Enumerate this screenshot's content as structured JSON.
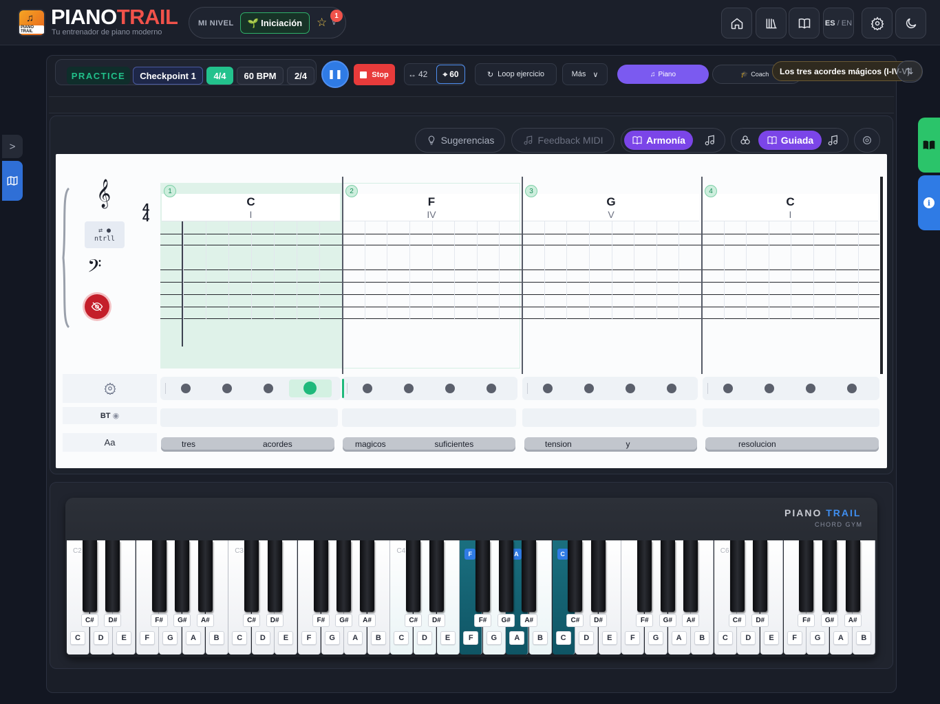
{
  "app": {
    "brand_part1": "PIANO",
    "brand_part2": "TRAIL",
    "logo_text": "PIANO TRAIL",
    "tagline": "Tu entrenador de piano moderno"
  },
  "level": {
    "label": "MI NIVEL",
    "value": "Iniciación",
    "notification_count": "1"
  },
  "header_buttons": {
    "home": "home-icon",
    "library": "library-icon",
    "book": "book-icon",
    "lang_active": "ES",
    "lang_sep": "/",
    "lang_other": "EN",
    "settings": "gear-icon",
    "theme": "moon-icon"
  },
  "toolbar": {
    "mode": "PRACTICE",
    "checkpoint": "Checkpoint 1",
    "meter": "4/4",
    "bpm": "60 BPM",
    "position": "2/4",
    "stop_label": "Stop",
    "width_value": "42",
    "target_value": "60",
    "loop_label": "Loop ejercicio",
    "more_label": "Más",
    "piano_tab": "Piano",
    "coach_tab": "Coach",
    "tooltip": "Los tres acordes mágicos (I-IV-V)"
  },
  "score_chips": {
    "suggestions": "Sugerencias",
    "midi_feedback": "Feedback MIDI",
    "harmony": "Armonía",
    "guided": "Guiada"
  },
  "score": {
    "time_signature_top": "4",
    "time_signature_bottom": "4",
    "control_label": "ntrll",
    "bt_label": "BT",
    "lyrics_row_label": "Aa",
    "measures": [
      {
        "number": "1",
        "chord": "C",
        "roman": "I"
      },
      {
        "number": "2",
        "chord": "F",
        "roman": "IV"
      },
      {
        "number": "3",
        "chord": "G",
        "roman": "V"
      },
      {
        "number": "4",
        "chord": "C",
        "roman": "I"
      }
    ],
    "current_measure": 1,
    "current_beat": 4,
    "lyrics": [
      [
        "tres",
        "acordes"
      ],
      [
        "magicos",
        "suficientes"
      ],
      [
        "tension",
        "y"
      ],
      [
        "resolucion"
      ]
    ]
  },
  "keyboard": {
    "brand_part1": "PIANO",
    "brand_part2": "TRAIL",
    "subtitle": "CHORD GYM",
    "octave_labels": [
      "C2",
      "C3",
      "C4",
      "C6"
    ],
    "white_keys": [
      "C",
      "D",
      "E",
      "F",
      "G",
      "A",
      "B",
      "C",
      "D",
      "E",
      "F",
      "G",
      "A",
      "B",
      "C",
      "D",
      "E",
      "F",
      "G",
      "A",
      "B",
      "C",
      "D",
      "E",
      "F",
      "G",
      "A",
      "B",
      "C",
      "D",
      "E",
      "F",
      "G",
      "A",
      "B"
    ],
    "black_keys": [
      "C#",
      "D#",
      "F#",
      "G#",
      "A#",
      "C#",
      "D#",
      "F#",
      "G#",
      "A#",
      "C#",
      "D#",
      "F#",
      "G#",
      "A#",
      "C#",
      "D#",
      "F#",
      "G#",
      "A#",
      "C#",
      "D#",
      "F#",
      "G#",
      "A#"
    ],
    "highlighted_notes": [
      "F",
      "A",
      "C"
    ]
  },
  "colors": {
    "accent": "#2f7be5",
    "brand_red": "#f0524a",
    "active_green": "#1fb97b",
    "purple": "#7b45e8",
    "highlight_key": "#0f5565"
  }
}
